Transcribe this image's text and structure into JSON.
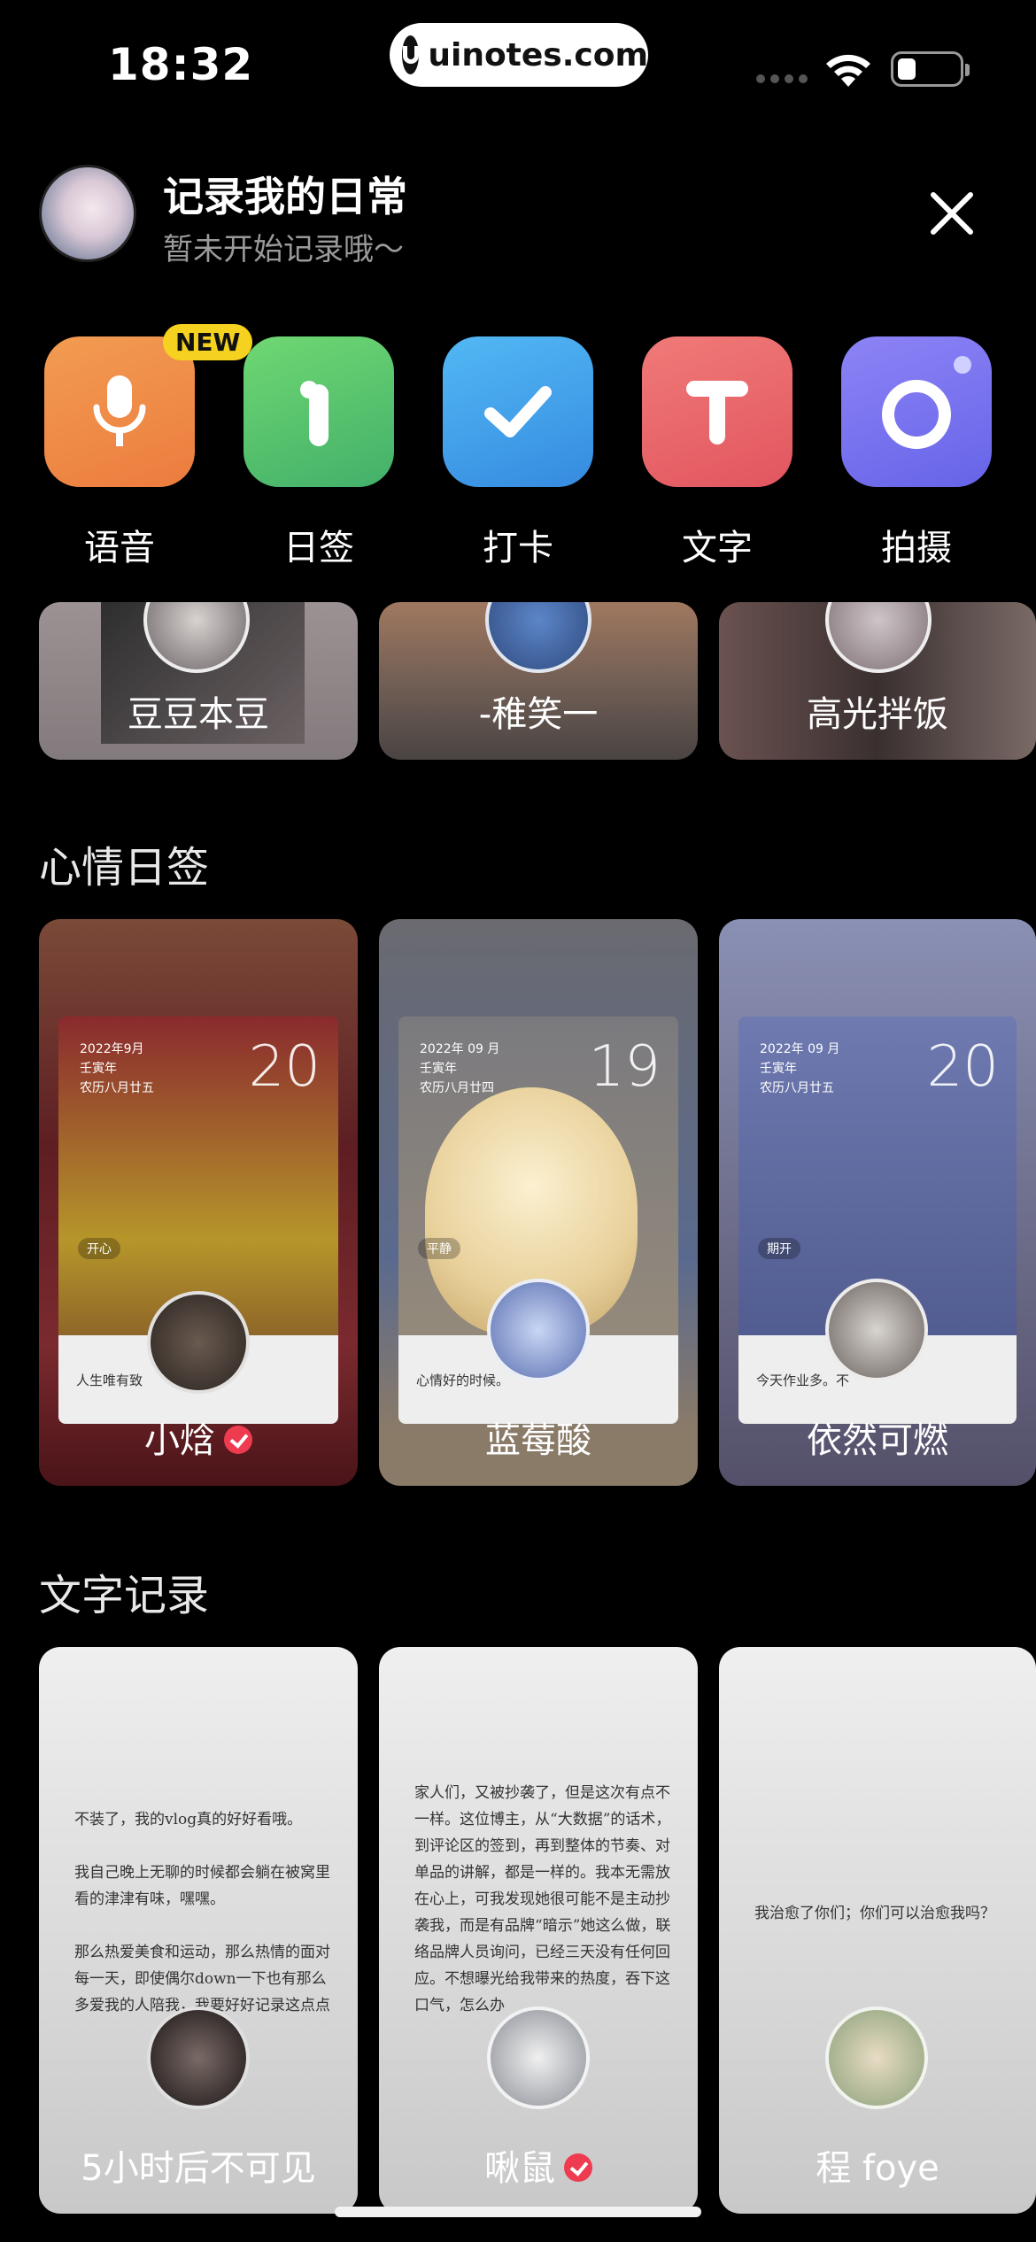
{
  "status_bar": {
    "time": "18:32",
    "url": "uinotes.com"
  },
  "header": {
    "title": "记录我的日常",
    "subtitle": "暂未开始记录哦～"
  },
  "actions": [
    {
      "label": "语音",
      "icon": "microphone-icon",
      "badge": "NEW",
      "color_from": "#f19a50",
      "color_to": "#ef7f3d"
    },
    {
      "label": "日签",
      "icon": "number-one-icon",
      "color_from": "#6ad46f",
      "color_to": "#45b56a"
    },
    {
      "label": "打卡",
      "icon": "checkmark-icon",
      "color_from": "#4bb0f2",
      "color_to": "#3a8fe3"
    },
    {
      "label": "文字",
      "icon": "letter-t-icon",
      "color_from": "#ee7575",
      "color_to": "#e35862"
    },
    {
      "label": "拍摄",
      "icon": "camera-ring-icon",
      "color_from": "#8a7ef5",
      "color_to": "#6a66ea"
    }
  ],
  "top_row": [
    {
      "name": "豆豆本豆"
    },
    {
      "name": "-稚笑一"
    },
    {
      "name": "高光拌饭"
    }
  ],
  "mood_section": {
    "title": "心情日签",
    "cards": [
      {
        "name": "小焓",
        "verified": true,
        "date_lines": [
          "2022年9月",
          "壬寅年",
          "农历八月廿五"
        ],
        "day": "20",
        "mood": "开心",
        "text": "人生唯有致"
      },
      {
        "name": "蓝莓酸",
        "verified": false,
        "date_lines": [
          "2022年 09 月",
          "壬寅年",
          "农历八月廿四"
        ],
        "day": "19",
        "mood": "平静",
        "text": "心情好的时候。"
      },
      {
        "name": "依然可燃",
        "verified": false,
        "date_lines": [
          "2022年 09 月",
          "壬寅年",
          "农历八月廿五"
        ],
        "day": "20",
        "mood": "期开",
        "text": "今天作业多。不"
      }
    ]
  },
  "text_section": {
    "title": "文字记录",
    "cards": [
      {
        "name": "5小时后不可见",
        "verified": false,
        "paragraphs": [
          "不装了，我的vlog真的好好看哦。",
          "我自己晚上无聊的时候都会躺在被窝里看的津津有味，嘿嘿。",
          "那么热爱美食和运动，那么热情的面对每一天，即使偶尔down一下也有那么多爱我的人陪我，我要好好记录这点点滴滴都在正向循环"
        ]
      },
      {
        "name": "啾鼠",
        "verified": true,
        "paragraphs": [
          "家人们，又被抄袭了，但是这次有点不一样。这位博主，从“大数据”的话术，到评论区的签到，再到整体的节奏、对单品的讲解，都是一样的。我本无需放在心上，可我发现她很可能不是主动抄袭我，而是有品牌“暗示”她这么做，联络品牌人员询问，已经三天没有任何回应。不想曝光给我带来的热度，吞下这口气，怎么办"
        ]
      },
      {
        "name": "程 foye",
        "verified": false,
        "paragraphs": [
          "我治愈了你们；你们可以治愈我吗？"
        ]
      }
    ]
  }
}
